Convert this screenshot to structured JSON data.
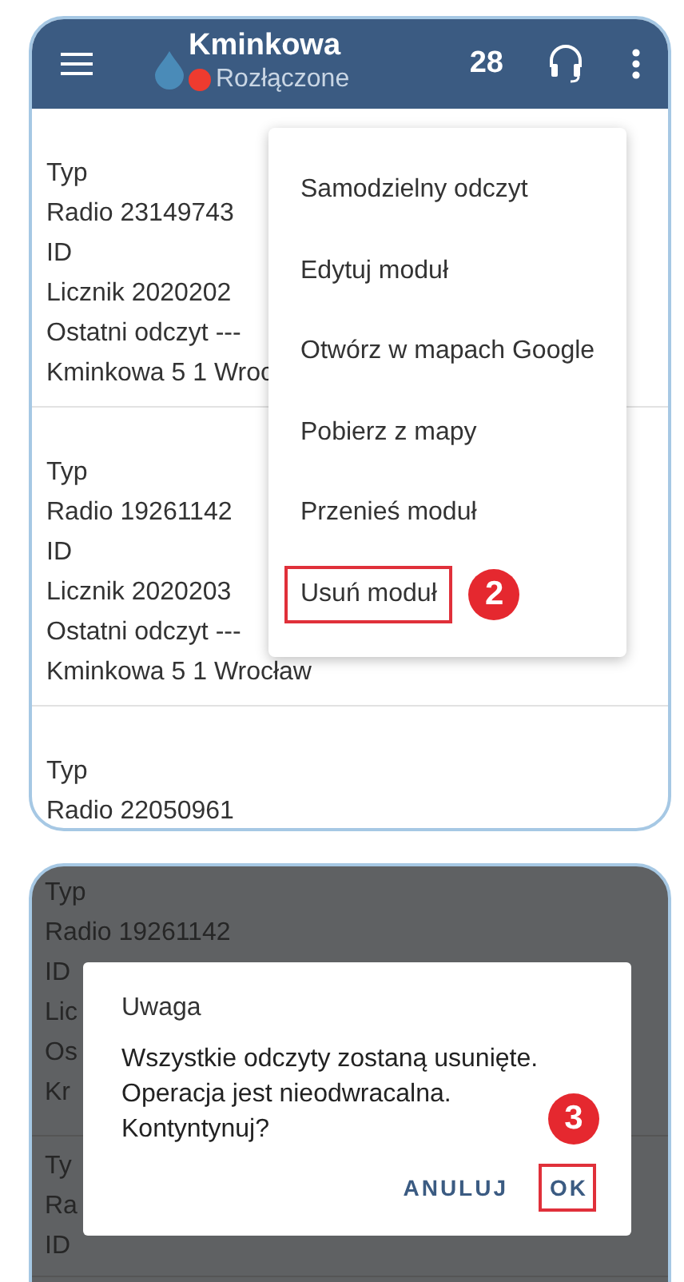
{
  "top_screen": {
    "app_bar": {
      "title": "Kminkowa",
      "status": "Rozłączone",
      "count": "28"
    },
    "modules": [
      {
        "lines": [
          "Typ",
          "Radio 23149743",
          "ID",
          "Licznik 2020202",
          "Ostatni odczyt ---",
          "Kminkowa 5 1 Wroc"
        ]
      },
      {
        "lines": [
          "Typ",
          "Radio 19261142",
          "ID",
          "Licznik 2020203",
          "Ostatni odczyt ---",
          "Kminkowa 5 1 Wrocław"
        ]
      },
      {
        "lines": [
          "Typ",
          "Radio 22050961"
        ]
      }
    ],
    "menu": {
      "items": [
        {
          "label": "Samodzielny odczyt",
          "highlighted": false
        },
        {
          "label": "Edytuj moduł",
          "highlighted": false
        },
        {
          "label": "Otwórz w mapach Google",
          "highlighted": false
        },
        {
          "label": "Pobierz z mapy",
          "highlighted": false
        },
        {
          "label": "Przenieś moduł",
          "highlighted": false
        },
        {
          "label": "Usuń moduł",
          "highlighted": true,
          "step": "2"
        }
      ]
    }
  },
  "bottom_screen": {
    "background_modules": [
      {
        "lines": [
          "Typ",
          "Radio 19261142",
          "ID",
          "Lic",
          "Os",
          "Kr"
        ]
      },
      {
        "lines": [
          "Ty",
          "Ra",
          "ID"
        ]
      }
    ],
    "dialog": {
      "title": "Uwaga",
      "message": "Wszystkie odczyty zostaną usunięte.\nOperacja jest nieodwracalna.\nKontyntynuj?",
      "buttons": [
        {
          "label": "ANULUJ",
          "highlighted": false
        },
        {
          "label": "OK",
          "highlighted": true,
          "step": "3"
        }
      ]
    }
  }
}
